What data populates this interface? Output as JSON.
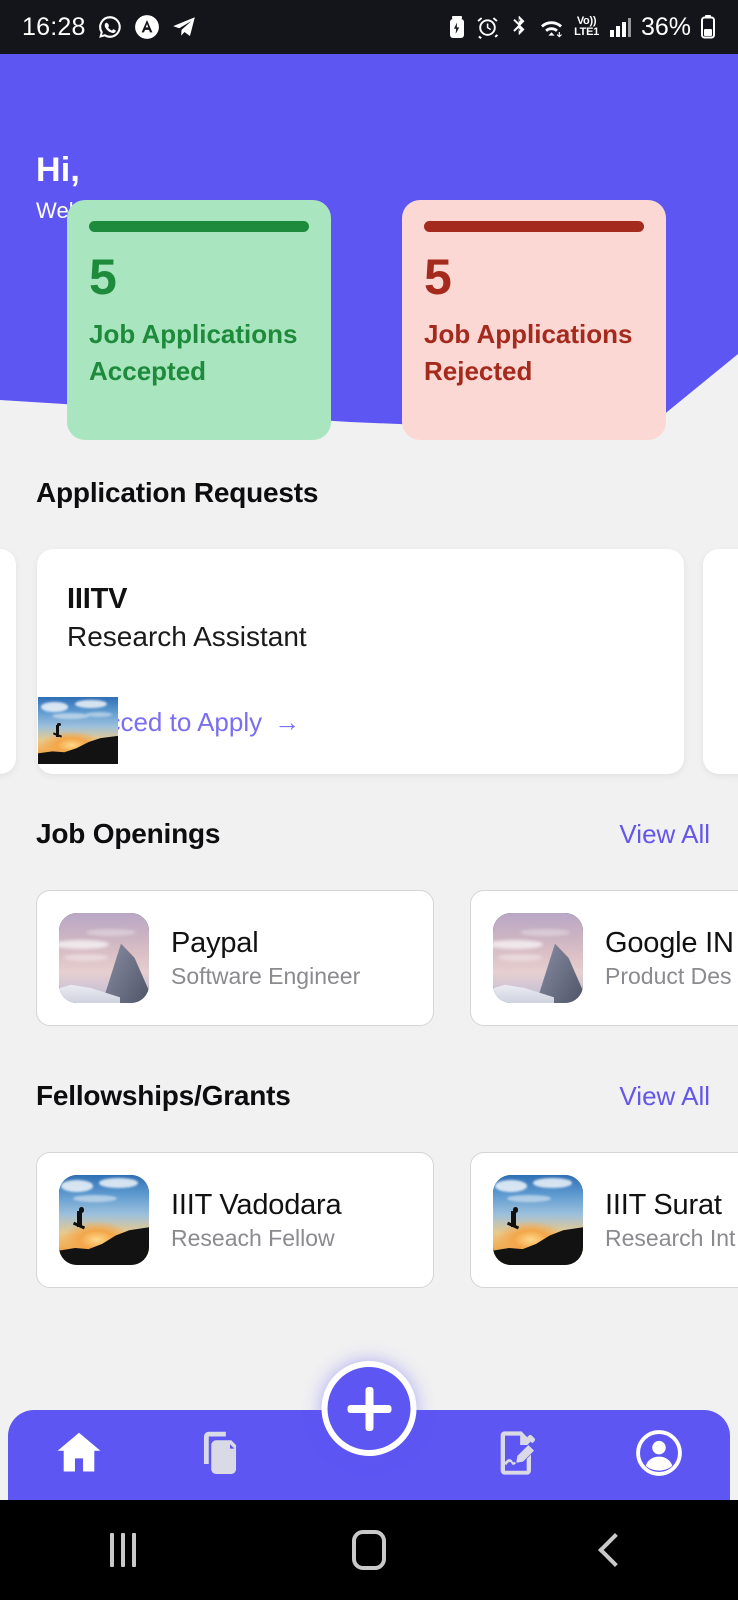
{
  "status_bar": {
    "time": "16:28",
    "left_icons": [
      "whatsapp-icon",
      "app-a-icon",
      "telegram-icon"
    ],
    "right_icons": [
      "battery-saver-icon",
      "alarm-icon",
      "bluetooth-icon",
      "wifi-icon"
    ],
    "network": {
      "volte": "Vo))",
      "lte": "LTE1"
    },
    "battery_percent": "36%"
  },
  "header": {
    "greeting": "Hi,",
    "subtitle": "Welcome to Docchain",
    "background_color": "#5d56f3"
  },
  "stats": [
    {
      "count": "5",
      "label": "Job Applications Accepted",
      "accent": "#1e8a3c",
      "background": "#a9e5bf"
    },
    {
      "count": "5",
      "label": "Job Applications Rejected",
      "accent": "#a52a1e",
      "background": "#fbd8d3"
    }
  ],
  "application_requests": {
    "title": "Application Requests",
    "card": {
      "organization": "IIITV",
      "role": "Research Assistant",
      "action": "Procced to Apply",
      "action_arrow": "→",
      "thumbnail": "sunset-jumper-photo"
    }
  },
  "job_openings": {
    "title": "Job Openings",
    "view_all": "View All",
    "items": [
      {
        "name": "Paypal",
        "role": "Software Engineer",
        "thumbnail": "alpine-sunset-photo"
      },
      {
        "name": "Google IN",
        "role": "Product Des",
        "thumbnail": "alpine-sunset-photo"
      }
    ]
  },
  "fellowships": {
    "title": "Fellowships/Grants",
    "view_all": "View All",
    "items": [
      {
        "name": "IIIT Vadodara",
        "role": "Reseach Fellow",
        "thumbnail": "sunset-jumper-photo"
      },
      {
        "name": "IIIT Surat",
        "role": "Research Int",
        "thumbnail": "sunset-jumper-photo"
      }
    ]
  },
  "bottom_nav": {
    "background": "#5d56f3",
    "items": [
      {
        "icon": "home-icon",
        "active": true
      },
      {
        "icon": "documents-icon",
        "active": false
      },
      {
        "icon": "sign-document-icon",
        "active": false
      },
      {
        "icon": "profile-icon",
        "active": false
      }
    ],
    "fab": {
      "icon": "plus-icon"
    }
  },
  "android_nav": {
    "recents": "recents-icon",
    "home": "home-square-icon",
    "back": "back-chevron-icon"
  }
}
